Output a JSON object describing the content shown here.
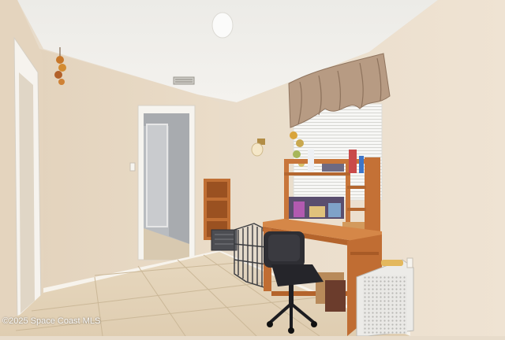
{
  "photo": {
    "watermark": "©2025 Space Coast MLS",
    "colors": {
      "wall": "#ece0cf",
      "ceiling": "#f2f1ee",
      "floor_tile": "#e5d6bd",
      "desk_wood": "#c8763a",
      "curtain": "#b79a82",
      "chair": "#2e2e33",
      "fan": "#ecebe8"
    },
    "objects": [
      "ceiling-light",
      "air-vent",
      "left-door-frame",
      "hanging-ornament",
      "hallway-doorway",
      "small-bookshelf",
      "pet-crate",
      "storage-basket",
      "wall-sconce",
      "window-blinds",
      "window-valance",
      "desk-hutch",
      "office-chair",
      "box-fan",
      "tile-floor"
    ]
  }
}
